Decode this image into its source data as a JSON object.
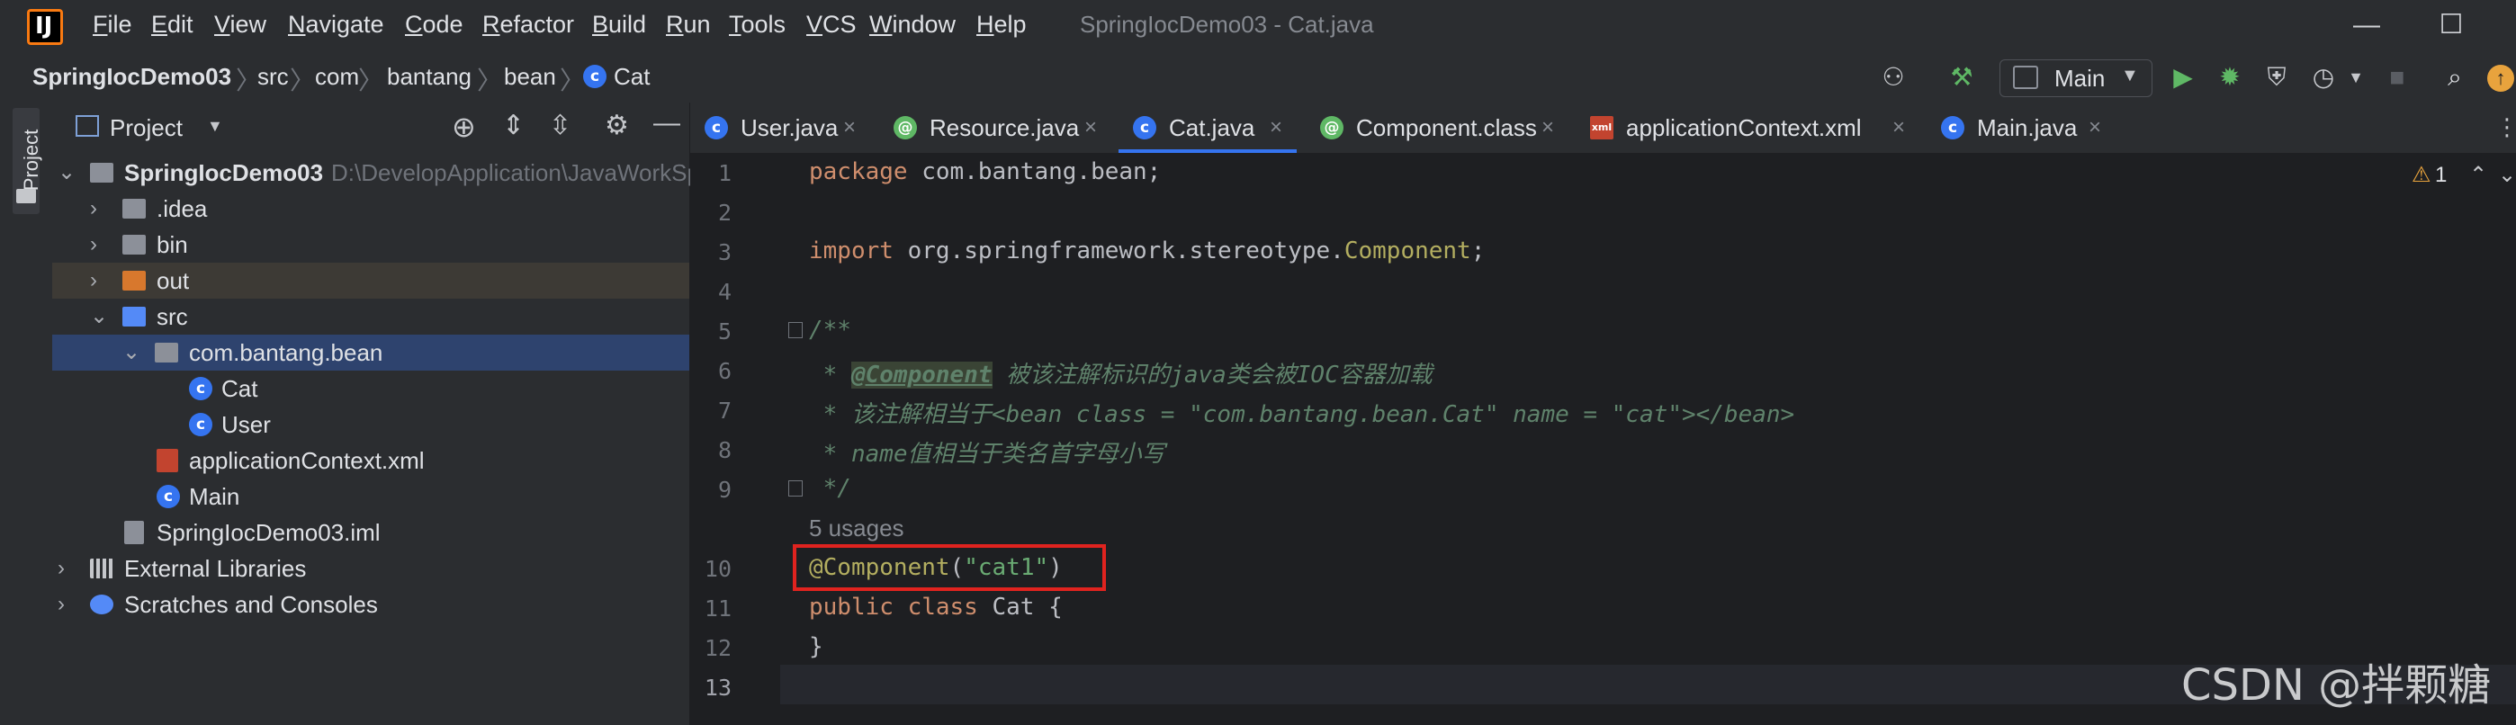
{
  "menu": [
    "File",
    "Edit",
    "View",
    "Navigate",
    "Code",
    "Refactor",
    "Build",
    "Run",
    "Tools",
    "VCS",
    "Window",
    "Help"
  ],
  "window_title": "SpringIocDemo03 - Cat.java",
  "breadcrumb": [
    "SpringIocDemo03",
    "src",
    "com",
    "bantang",
    "bean",
    "Cat"
  ],
  "run_config": "Main",
  "project_panel": {
    "title": "Project",
    "tool_tab": "Project",
    "tree": [
      {
        "label": "SpringIocDemo03",
        "path": "D:\\DevelopApplication\\JavaWorkSp"
      },
      {
        "label": ".idea"
      },
      {
        "label": "bin"
      },
      {
        "label": "out"
      },
      {
        "label": "src"
      },
      {
        "label": "com.bantang.bean"
      },
      {
        "label": "Cat"
      },
      {
        "label": "User"
      },
      {
        "label": "applicationContext.xml"
      },
      {
        "label": "Main"
      },
      {
        "label": "SpringIocDemo03.iml"
      },
      {
        "label": "External Libraries"
      },
      {
        "label": "Scratches and Consoles"
      }
    ]
  },
  "tabs": [
    {
      "label": "User.java",
      "icon": "c"
    },
    {
      "label": "Resource.java",
      "icon": "@"
    },
    {
      "label": "Cat.java",
      "icon": "c"
    },
    {
      "label": "Component.class",
      "icon": "@"
    },
    {
      "label": "applicationContext.xml",
      "icon": "xml"
    },
    {
      "label": "Main.java",
      "icon": "c"
    }
  ],
  "editor": {
    "line_numbers": [
      "1",
      "2",
      "3",
      "4",
      "5",
      "6",
      "7",
      "8",
      "9",
      "10",
      "11",
      "12",
      "13"
    ],
    "usages": "5 usages",
    "warning_count": "1",
    "code": {
      "l1_kw": "package",
      "l1_rest": " com.bantang.bean;",
      "l3_kw": "import",
      "l3_rest": " org.springframework.stereotype.",
      "l3_cls": "Component",
      "l3_end": ";",
      "l5": "/**",
      "l6_prefix": " * ",
      "l6_tag": "@Component",
      "l6_text": " 被该注解标识的java类会被IOC容器加载",
      "l7": " * 该注解相当于<bean class = \"com.bantang.bean.Cat\" name = \"cat\"></bean>",
      "l8": " * name值相当于类名首字母小写",
      "l9": " */",
      "l10_ann": "@Component",
      "l10_open": "(",
      "l10_str": "\"cat1\"",
      "l10_close": ")",
      "l11_kw": "public class",
      "l11_rest": " Cat {",
      "l12": "}"
    }
  },
  "watermark": "CSDN @拌颗糖"
}
